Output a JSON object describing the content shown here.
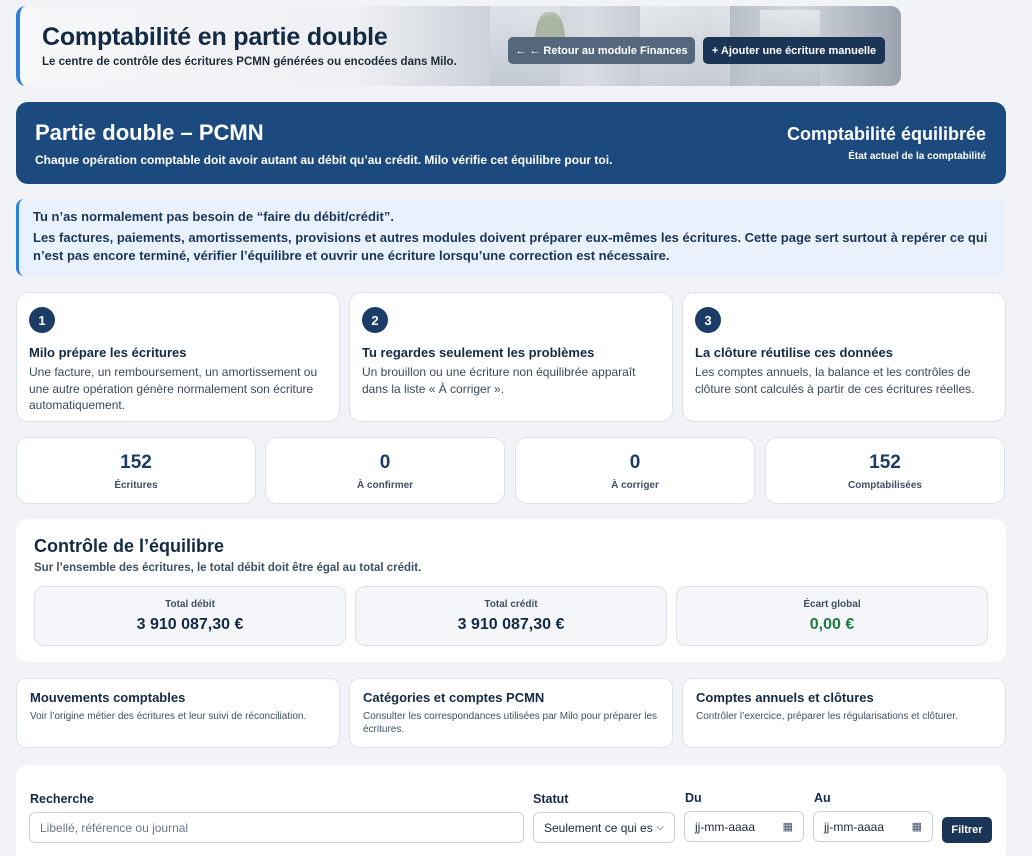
{
  "header": {
    "title": "Comptabilité en partie double",
    "subtitle": "Le centre de contrôle des écritures PCMN générées ou encodées dans Milo.",
    "back_button": "← ← Retour au module Finances",
    "add_button": "+ Ajouter une écriture manuelle"
  },
  "banner": {
    "title": "Partie double – PCMN",
    "subtitle": "Chaque opération comptable doit avoir autant au débit qu’au crédit. Milo vérifie cet équilibre pour toi.",
    "status": "Comptabilité équilibrée",
    "status_caption": "État actuel de la comptabilité"
  },
  "info": {
    "title": "Tu n’as normalement pas besoin de “faire du débit/crédit”.",
    "body": "Les factures, paiements, amortissements, provisions et autres modules doivent préparer eux-mêmes les écritures. Cette page sert surtout à repérer ce qui n’est pas encore terminé, vérifier l’équilibre et ouvrir une écriture lorsqu’une correction est nécessaire."
  },
  "steps": [
    {
      "num": "1",
      "title": "Milo prépare les écritures",
      "desc": "Une facture, un remboursement, un amortissement ou une autre opération génère normalement son écriture automatiquement."
    },
    {
      "num": "2",
      "title": "Tu regardes seulement les problèmes",
      "desc": "Un brouillon ou une écriture non équilibrée apparaît dans la liste « À corriger »."
    },
    {
      "num": "3",
      "title": "La clôture réutilise ces données",
      "desc": "Les comptes annuels, la balance et les contrôles de clôture sont calculés à partir de ces écritures réelles."
    }
  ],
  "stats": [
    {
      "value": "152",
      "label": "Écritures"
    },
    {
      "value": "0",
      "label": "À confirmer"
    },
    {
      "value": "0",
      "label": "À corriger"
    },
    {
      "value": "152",
      "label": "Comptabilisées"
    }
  ],
  "balance": {
    "title": "Contrôle de l’équilibre",
    "subtitle": "Sur l’ensemble des écritures, le total débit doit être égal au total crédit.",
    "totals": [
      {
        "label": "Total débit",
        "value": "3 910 087,30 €"
      },
      {
        "label": "Total crédit",
        "value": "3 910 087,30 €"
      },
      {
        "label": "Écart global",
        "value": "0,00 €"
      }
    ],
    "ok_color": "#1f7a3e"
  },
  "links": [
    {
      "title": "Mouvements comptables",
      "desc": "Voir l’origine métier des écritures et leur suivi de réconciliation."
    },
    {
      "title": "Catégories et comptes PCMN",
      "desc": "Consulter les correspondances utilisées par Milo pour préparer les écritures."
    },
    {
      "title": "Comptes annuels et clôtures",
      "desc": "Contrôler l’exercice, préparer les régularisations et clôturer."
    }
  ],
  "filters": {
    "search_label": "Recherche",
    "search_placeholder": "Libellé, référence ou journal",
    "status_label": "Statut",
    "status_value": "Seulement ce qui es",
    "from_label": "Du",
    "from_placeholder": "jj-mm-aaaa",
    "to_label": "Au",
    "to_placeholder": "jj-mm-aaaa",
    "filter_button": "Filtrer"
  },
  "colors": {
    "banner": "#1c4a7f",
    "primary_button": "#1b3556",
    "secondary_button": "#55677d",
    "info_bg": "#e9f2fc",
    "accent": "#2f7fd6"
  }
}
